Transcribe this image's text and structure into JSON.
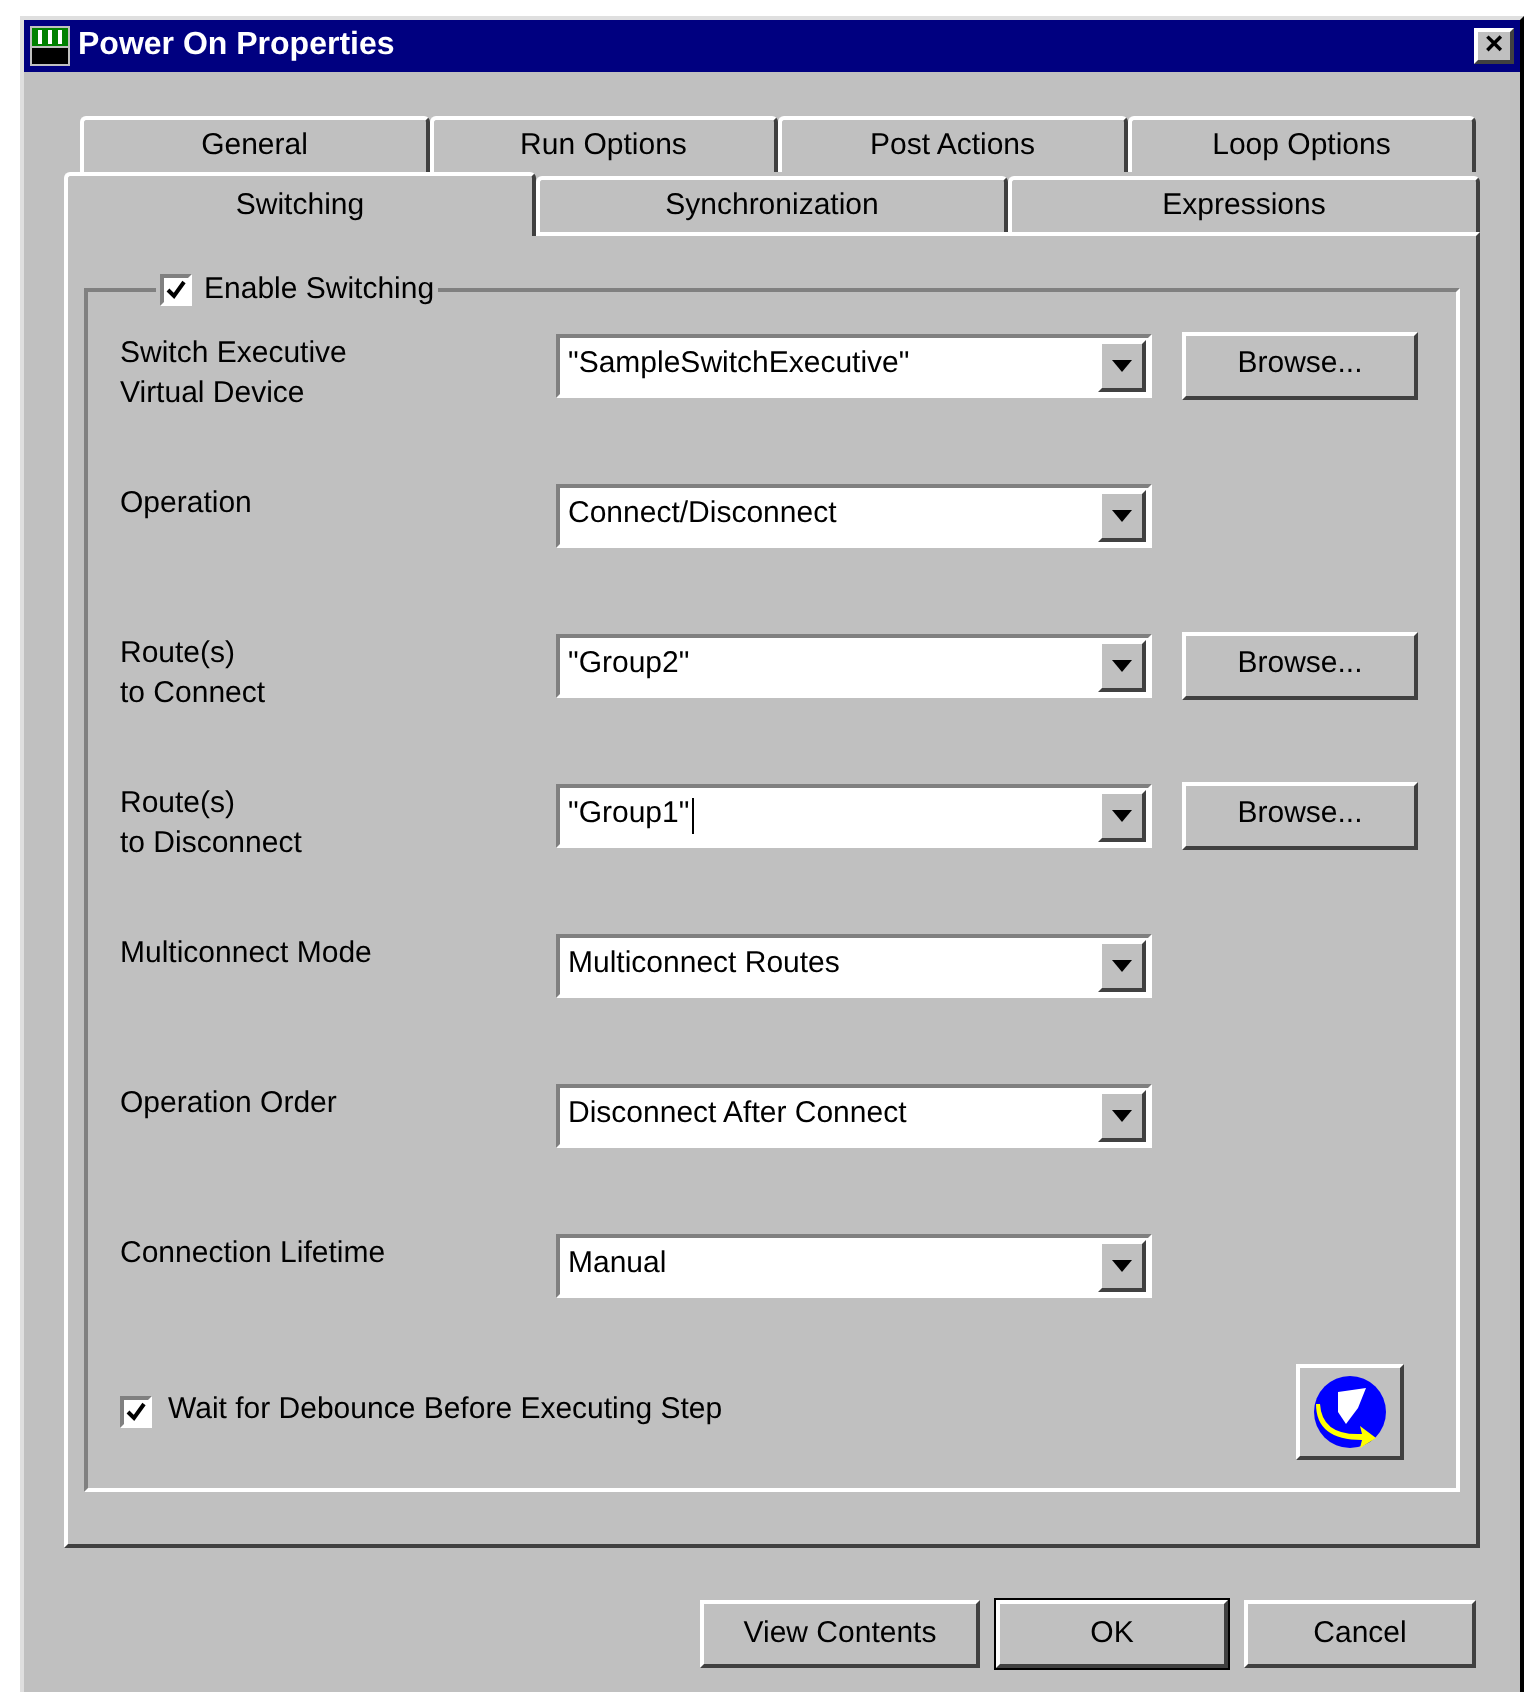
{
  "window": {
    "title": "Power On Properties",
    "close": "×"
  },
  "tab_rows": [
    [
      {
        "label": "General",
        "selected": false
      },
      {
        "label": "Run Options",
        "selected": false
      },
      {
        "label": "Post Actions",
        "selected": false
      },
      {
        "label": "Loop Options",
        "selected": false
      }
    ],
    [
      {
        "label": "Switching",
        "selected": true
      },
      {
        "label": "Synchronization",
        "selected": false
      },
      {
        "label": "Expressions",
        "selected": false
      }
    ]
  ],
  "group": {
    "label": "Enable Switching",
    "checked": true
  },
  "fields": [
    {
      "label": "Switch Executive\nVirtual Device",
      "value": "\"SampleSwitchExecutive\"",
      "browse": "Browse...",
      "focused": false
    },
    {
      "label": "Operation",
      "value": "Connect/Disconnect",
      "focused": false
    },
    {
      "label": "Route(s)\nto Connect",
      "value": "\"Group2\"",
      "browse": "Browse...",
      "focused": false
    },
    {
      "label": "Route(s)\nto Disconnect",
      "value": "\"Group1\"",
      "browse": "Browse...",
      "focused": true
    },
    {
      "label": "Multiconnect Mode",
      "value": "Multiconnect Routes",
      "focused": false
    },
    {
      "label": "Operation Order",
      "value": "Disconnect After Connect",
      "focused": false
    },
    {
      "label": "Connection Lifetime",
      "value": "Manual",
      "focused": false
    }
  ],
  "debounce": {
    "label": "Wait for Debounce Before Executing Step",
    "checked": true
  },
  "buttons": [
    {
      "label": "View Contents",
      "default": false
    },
    {
      "label": "OK",
      "default": true
    },
    {
      "label": "Cancel",
      "default": false
    }
  ]
}
